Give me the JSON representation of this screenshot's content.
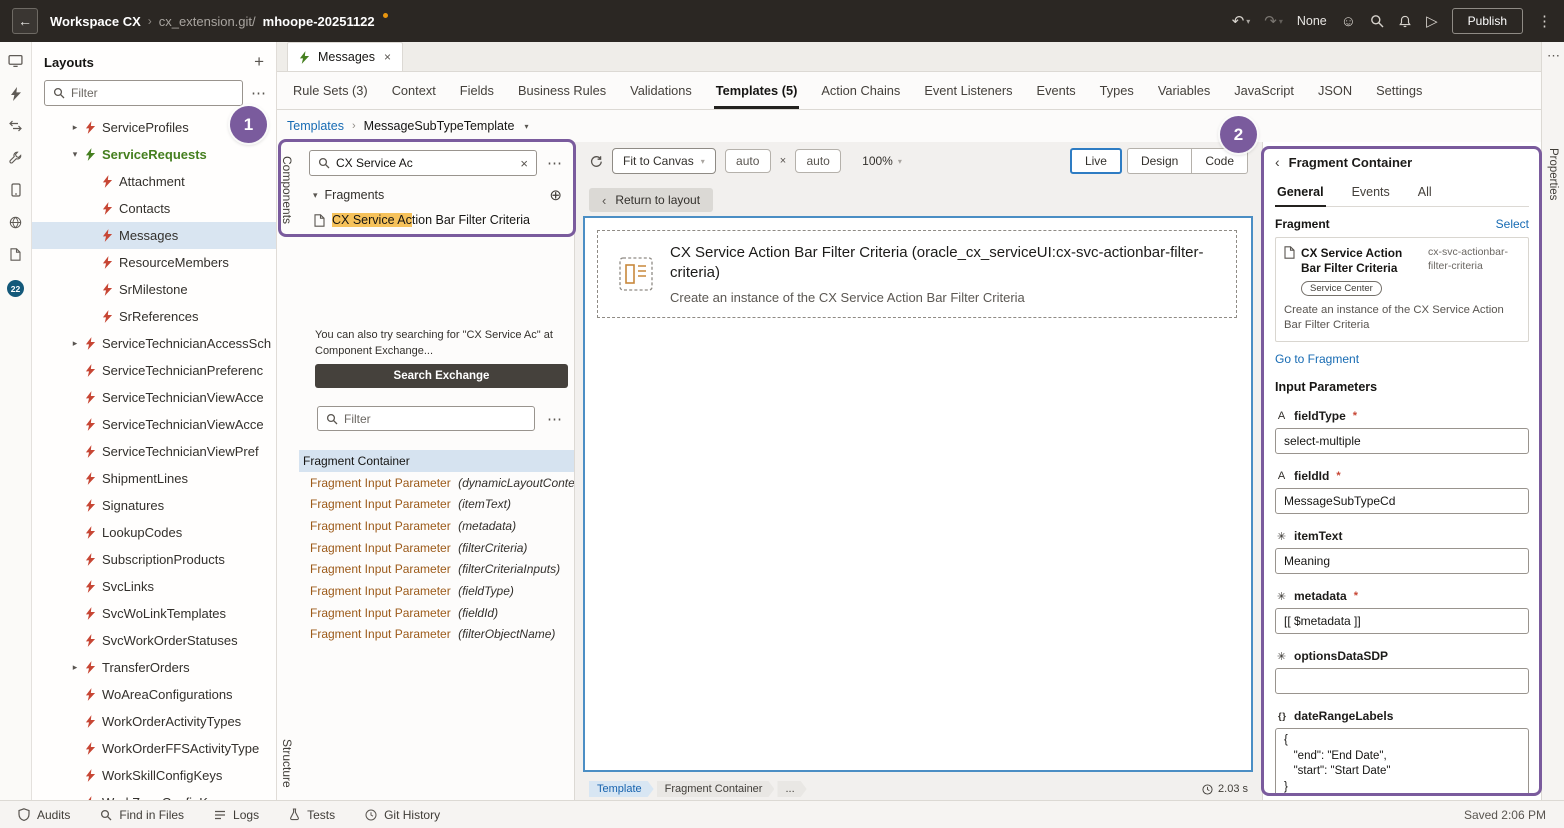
{
  "colors": {
    "annotation_purple": "#7a5b9d",
    "link_blue": "#176bb3",
    "icon_red": "#c74634",
    "modified_green": "#457f1f",
    "highlight_orange": "#f6c25b",
    "selection_bg": "#d9e5f1",
    "param_brown": "#9c5a19",
    "canvas_selection_blue": "#4b8ec4",
    "header_dark": "#2b2723"
  },
  "annotations": {
    "step1": "1",
    "step2": "2"
  },
  "topbar": {
    "workspace": "Workspace CX",
    "separator": "›",
    "repo": "cx_extension.git/",
    "branch": "mhoope-20251122",
    "sandbox": "None",
    "publish_label": "Publish"
  },
  "icon_rail": {
    "badge_count": "22"
  },
  "layouts_panel": {
    "title": "Layouts",
    "filter_placeholder": "Filter",
    "tree": [
      {
        "label": "ServiceProfiles",
        "level": 1,
        "arrow": "right"
      },
      {
        "label": "ServiceRequests",
        "level": 1,
        "arrow": "down",
        "green": true
      },
      {
        "label": "Attachment",
        "level": 2
      },
      {
        "label": "Contacts",
        "level": 2
      },
      {
        "label": "Messages",
        "level": 2,
        "selected": true
      },
      {
        "label": "ResourceMembers",
        "level": 2
      },
      {
        "label": "SrMilestone",
        "level": 2
      },
      {
        "label": "SrReferences",
        "level": 2
      },
      {
        "label": "ServiceTechnicianAccessSch",
        "level": 1,
        "arrow": "right"
      },
      {
        "label": "ServiceTechnicianPreferenc",
        "level": 1
      },
      {
        "label": "ServiceTechnicianViewAcce",
        "level": 1
      },
      {
        "label": "ServiceTechnicianViewAcce",
        "level": 1
      },
      {
        "label": "ServiceTechnicianViewPref",
        "level": 1
      },
      {
        "label": "ShipmentLines",
        "level": 1
      },
      {
        "label": "Signatures",
        "level": 1
      },
      {
        "label": "LookupCodes",
        "level": 1
      },
      {
        "label": "SubscriptionProducts",
        "level": 1
      },
      {
        "label": "SvcLinks",
        "level": 1
      },
      {
        "label": "SvcWoLinkTemplates",
        "level": 1
      },
      {
        "label": "SvcWorkOrderStatuses",
        "level": 1
      },
      {
        "label": "TransferOrders",
        "level": 1,
        "arrow": "right"
      },
      {
        "label": "WoAreaConfigurations",
        "level": 1
      },
      {
        "label": "WorkOrderActivityTypes",
        "level": 1
      },
      {
        "label": "WorkOrderFFSActivityType",
        "level": 1
      },
      {
        "label": "WorkSkillConfigKeys",
        "level": 1
      },
      {
        "label": "WorkZoneConfigKeys",
        "level": 1
      }
    ]
  },
  "doc_tabs": [
    {
      "label": "Messages"
    }
  ],
  "nav_tabs": [
    {
      "label": "Rule Sets (3)"
    },
    {
      "label": "Context"
    },
    {
      "label": "Fields"
    },
    {
      "label": "Business Rules"
    },
    {
      "label": "Validations"
    },
    {
      "label": "Templates (5)",
      "active": true
    },
    {
      "label": "Action Chains"
    },
    {
      "label": "Event Listeners"
    },
    {
      "label": "Events"
    },
    {
      "label": "Types"
    },
    {
      "label": "Variables"
    },
    {
      "label": "JavaScript"
    },
    {
      "label": "JSON"
    },
    {
      "label": "Settings"
    }
  ],
  "breadcrumb": {
    "root": "Templates",
    "current": "MessageSubTypeTemplate"
  },
  "components_panel": {
    "components_label": "Components",
    "structure_label": "Structure",
    "search_value": "CX Service Ac",
    "section_label": "Fragments",
    "result_highlight": "CX Service Ac",
    "result_rest": "tion Bar Filter Criteria",
    "exchange_hint": "You can also try searching for \"CX Service Ac\" at Component Exchange...",
    "exchange_button": "Search Exchange",
    "filter_placeholder": "Filter",
    "structure_items": [
      {
        "label": "Fragment Container",
        "container": true,
        "selected": true
      },
      {
        "label": "Fragment Input Parameter",
        "param": "(dynamicLayoutContext)"
      },
      {
        "label": "Fragment Input Parameter",
        "param": "(itemText)"
      },
      {
        "label": "Fragment Input Parameter",
        "param": "(metadata)"
      },
      {
        "label": "Fragment Input Parameter",
        "param": "(filterCriteria)"
      },
      {
        "label": "Fragment Input Parameter",
        "param": "(filterCriteriaInputs)"
      },
      {
        "label": "Fragment Input Parameter",
        "param": "(fieldType)"
      },
      {
        "label": "Fragment Input Parameter",
        "param": "(fieldId)"
      },
      {
        "label": "Fragment Input Parameter",
        "param": "(filterObjectName)"
      }
    ]
  },
  "canvas": {
    "toolbar": {
      "fit": "Fit to Canvas",
      "width": "auto",
      "height": "auto",
      "zoom": "100%",
      "live": "Live",
      "design": "Design",
      "code": "Code"
    },
    "return_button": "Return to layout",
    "fragment_title": "CX Service Action Bar Filter Criteria (oracle_cx_serviceUI:cx-svc-actionbar-filter-criteria)",
    "fragment_subtitle": "Create an instance of the CX Service Action Bar Filter Criteria",
    "breadcrumb": [
      "Template",
      "Fragment Container",
      "..."
    ],
    "render_time": "2.03 s"
  },
  "properties_panel": {
    "vertical_label": "Properties",
    "header": "Fragment Container",
    "tabs": [
      {
        "label": "General",
        "active": true
      },
      {
        "label": "Events"
      },
      {
        "label": "All"
      }
    ],
    "fragment_label": "Fragment",
    "select_link": "Select",
    "fragment_card": {
      "name": "CX Service Action Bar Filter Criteria",
      "code": "cx-svc-actionbar-filter-criteria",
      "badge": "Service Center",
      "description": "Create an instance of the CX Service Action Bar Filter Criteria"
    },
    "go_to_fragment": "Go to Fragment",
    "input_parameters_title": "Input Parameters",
    "parameters": [
      {
        "type": "string",
        "icon": "A",
        "name": "fieldType",
        "required": true,
        "kind": "input",
        "value": "select-multiple"
      },
      {
        "type": "string",
        "icon": "A",
        "name": "fieldId",
        "required": true,
        "kind": "input",
        "value": "MessageSubTypeCd"
      },
      {
        "type": "any",
        "icon": "✳",
        "name": "itemText",
        "required": false,
        "kind": "input",
        "value": "Meaning"
      },
      {
        "type": "any",
        "icon": "✳",
        "name": "metadata",
        "required": true,
        "kind": "input",
        "value": "[[ $metadata ]]"
      },
      {
        "type": "any",
        "icon": "✳",
        "name": "optionsDataSDP",
        "required": false,
        "kind": "input",
        "value": ""
      },
      {
        "type": "object",
        "icon": "{ }",
        "name": "dateRangeLabels",
        "required": false,
        "kind": "textarea",
        "value": "{\n   \"end\": \"End Date\",\n   \"start\": \"Start Date\"\n}"
      }
    ]
  },
  "statusbar": {
    "items": [
      {
        "label": "Audits",
        "icon": "shield"
      },
      {
        "label": "Find in Files",
        "icon": "magnifier"
      },
      {
        "label": "Logs",
        "icon": "logs"
      },
      {
        "label": "Tests",
        "icon": "flask"
      },
      {
        "label": "Git History",
        "icon": "clock"
      }
    ],
    "saved": "Saved 2:06 PM"
  }
}
